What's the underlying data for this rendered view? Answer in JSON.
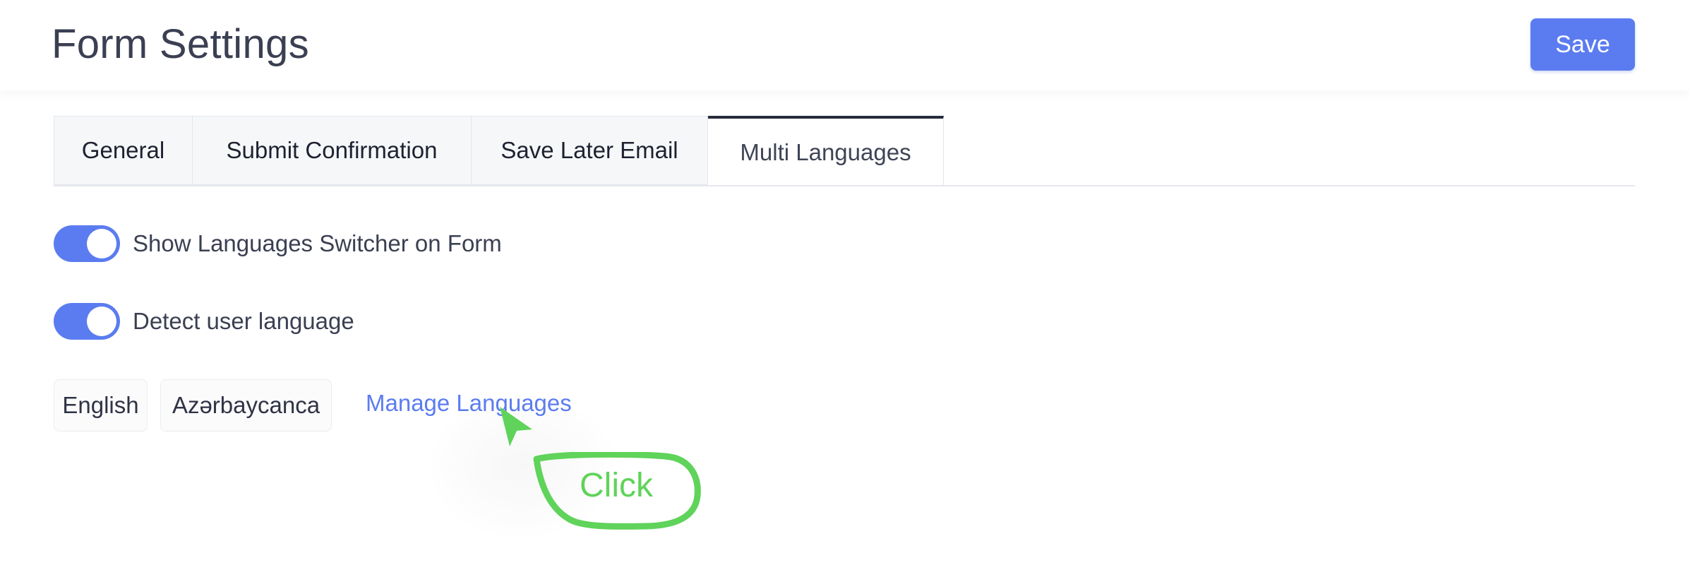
{
  "header": {
    "title": "Form Settings",
    "save_label": "Save"
  },
  "tabs": [
    {
      "label": "General",
      "active": false
    },
    {
      "label": "Submit Confirmation",
      "active": false
    },
    {
      "label": "Save Later Email",
      "active": false
    },
    {
      "label": "Multi Languages",
      "active": true
    }
  ],
  "settings": {
    "show_switcher": {
      "label": "Show Languages Switcher on Form",
      "enabled": true
    },
    "detect_language": {
      "label": "Detect user language",
      "enabled": true
    }
  },
  "languages": [
    "English",
    "Azərbaycanca"
  ],
  "manage_link": "Manage Languages",
  "annotation": {
    "text": "Click",
    "color": "#5fd35a"
  },
  "colors": {
    "accent": "#5b7cf0",
    "title": "#3b3f52",
    "annotation": "#5fd35a"
  }
}
